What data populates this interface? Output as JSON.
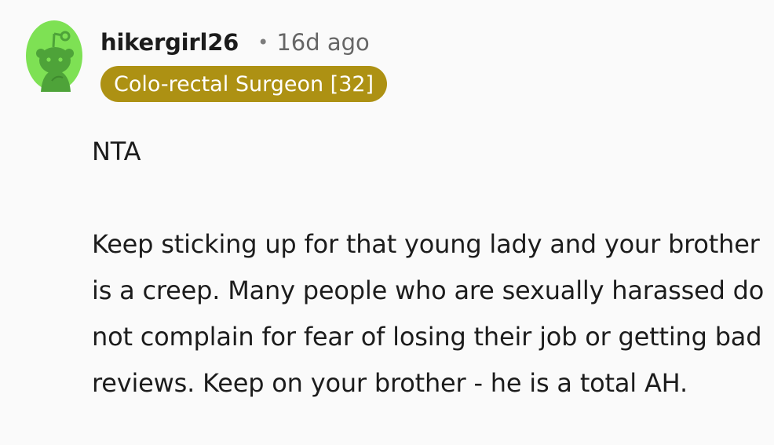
{
  "comment": {
    "author": "hikergirl26",
    "separator": "•",
    "time_ago": "16d ago",
    "flair": {
      "text": "Colo-rectal Surgeon [32]",
      "color": "#ad9113"
    },
    "avatar": {
      "icon": "snoo-avatar-icon",
      "background_color": "#7ee154",
      "figure_color": "#4ea339"
    },
    "body": {
      "paragraph_1": "NTA",
      "paragraph_2": "Keep sticking up for that young lady and your brother is a creep. Many people who are sexually harassed do not complain for fear of losing their job or getting bad reviews. Keep on your brother - he is a total AH."
    }
  }
}
